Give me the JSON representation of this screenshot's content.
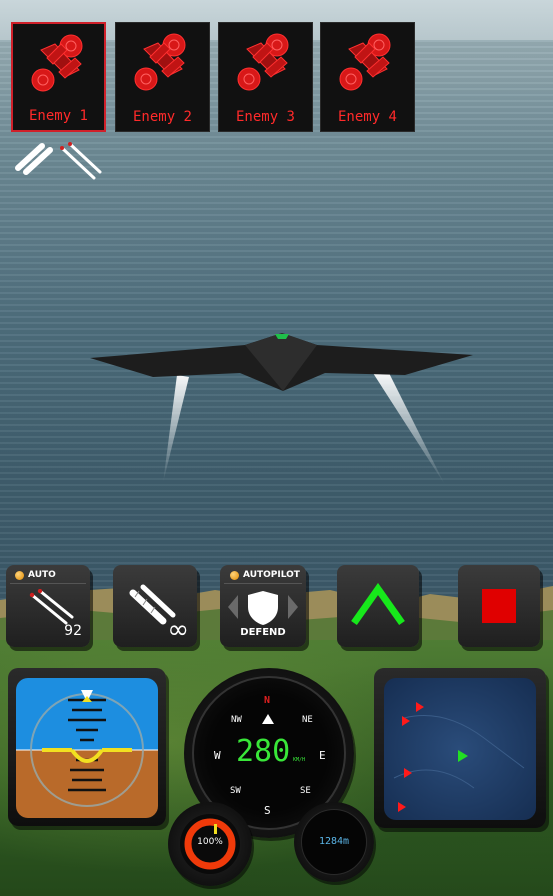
{
  "enemies": [
    {
      "label": "Enemy 1",
      "selected": true
    },
    {
      "label": "Enemy 2",
      "selected": false
    },
    {
      "label": "Enemy 3",
      "selected": false
    },
    {
      "label": "Enemy 4",
      "selected": false
    }
  ],
  "weapons": {
    "auto_tag": "AUTO",
    "missile_count": "92",
    "gun_count": "∞",
    "autopilot_tag": "AUTOPILOT",
    "autopilot_mode": "DEFEND"
  },
  "compass": {
    "n": "N",
    "ne": "NE",
    "e": "E",
    "se": "SE",
    "s": "S",
    "sw": "SW",
    "w": "W",
    "nw": "NW",
    "speed": "280",
    "speed_unit": "KM/H"
  },
  "throttle": {
    "value": "100%",
    "fill": 1.0
  },
  "altitude": {
    "value": "1284m"
  },
  "colors": {
    "enemy_red": "#ff2a2a",
    "speed_green": "#39e639",
    "climb_green": "#17e81b",
    "stop_red": "#e00000",
    "altitude_blue": "#5ab4e6"
  },
  "icons": [
    "enemy-jet-icon",
    "missile-icon",
    "gun-ammo-icon",
    "shield-icon",
    "chevron-up-icon",
    "stop-square-icon"
  ]
}
